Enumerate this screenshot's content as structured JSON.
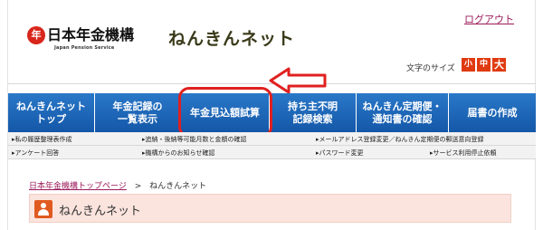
{
  "header": {
    "logo_mark": "年",
    "logo_text": "日本年金機構",
    "logo_en": "Japan Pension Service",
    "site_title": "ねんきんネット",
    "logout": "ログアウト",
    "font_size_label": "文字のサイズ",
    "font_sizes": [
      "小",
      "中",
      "大"
    ]
  },
  "nav": {
    "items": [
      {
        "label": "ねんきんネット\nトップ"
      },
      {
        "label": "年金記録の\n一覧表示"
      },
      {
        "label": "年金見込額試算"
      },
      {
        "label": "持ち主不明\n記録検索"
      },
      {
        "label": "ねんきん定期便・\n通知書の確認"
      },
      {
        "label": "届書の作成"
      }
    ]
  },
  "sublinks": {
    "row1": [
      "▸私の履歴整理表作成",
      "▸追納・後納等可能月数と金額の確認",
      "▸メールアドレス登録変更／ねんきん定期便の郵送意向登録"
    ],
    "row2": [
      "▸アンケート回答",
      "▸機構からのお知らせ確認",
      "▸パスワード変更",
      "▸サービス利用停止依頼"
    ]
  },
  "breadcrumb": {
    "home": "日本年金機構トップページ",
    "sep": ">",
    "current": "ねんきんネット"
  },
  "content": {
    "title": "ねんきんネット"
  },
  "colors": {
    "nav_blue": "#1a64b4",
    "highlight_red": "#e02020",
    "font_btn": "#e03a10",
    "link": "#9b1a5a"
  }
}
